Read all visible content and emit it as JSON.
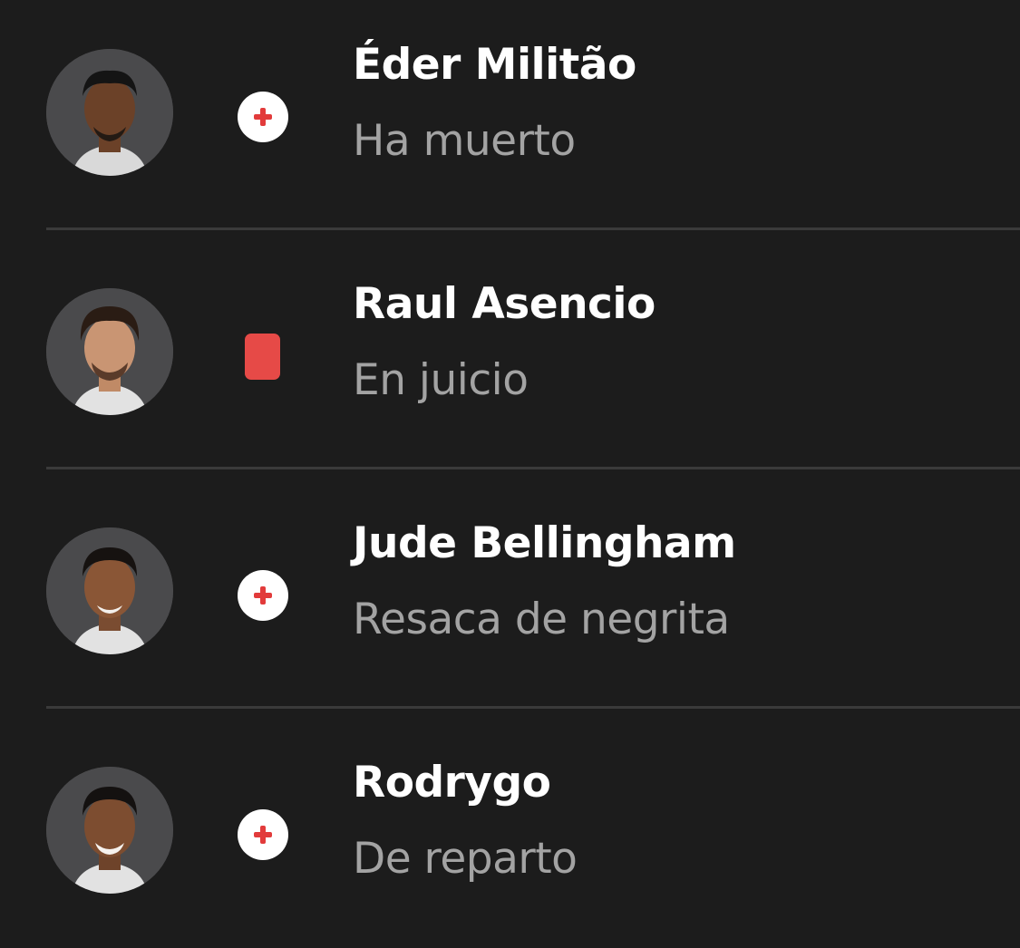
{
  "colors": {
    "background": "#1c1c1c",
    "name_text": "#ffffff",
    "desc_text": "#a3a3a3",
    "divider": "#3a3a3a",
    "injury_red": "#e23b3b",
    "card_red": "#e64a47"
  },
  "players": [
    {
      "name": "Éder Militão",
      "status": "Ha muerto",
      "status_icon": "injury-cross-icon"
    },
    {
      "name": "Raul Asencio",
      "status": "En juicio",
      "status_icon": "red-card-icon"
    },
    {
      "name": "Jude Bellingham",
      "status": "Resaca de negrita",
      "status_icon": "injury-cross-icon"
    },
    {
      "name": "Rodrygo",
      "status": "De reparto",
      "status_icon": "injury-cross-icon"
    }
  ]
}
